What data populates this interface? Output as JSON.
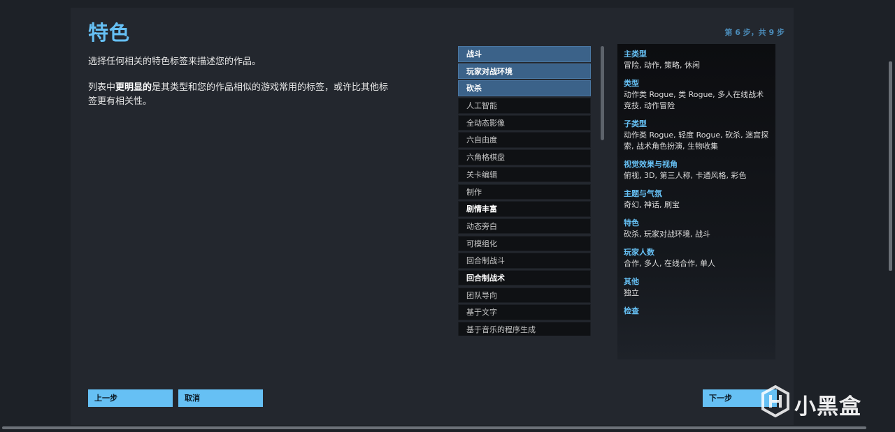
{
  "header": {
    "title": "特色",
    "step": "第 6 步，共 9 步"
  },
  "description": {
    "line1": "选择任何相关的特色标签来描述您的作品。",
    "line2_prefix": "列表中",
    "line2_bold": "更明显的",
    "line2_suffix": "是其类型和您的作品相似的游戏常用的标签，或许比其他标签更有相关性。"
  },
  "tags": [
    {
      "label": "战斗",
      "state": "selected"
    },
    {
      "label": "玩家对战环境",
      "state": "selected"
    },
    {
      "label": "砍杀",
      "state": "selected"
    },
    {
      "label": "人工智能",
      "state": "normal"
    },
    {
      "label": "全动态影像",
      "state": "normal"
    },
    {
      "label": "六自由度",
      "state": "normal"
    },
    {
      "label": "六角格棋盘",
      "state": "normal"
    },
    {
      "label": "关卡编辑",
      "state": "normal"
    },
    {
      "label": "制作",
      "state": "normal"
    },
    {
      "label": "剧情丰富",
      "state": "bold"
    },
    {
      "label": "动态旁白",
      "state": "normal"
    },
    {
      "label": "可模组化",
      "state": "normal"
    },
    {
      "label": "回合制战斗",
      "state": "normal"
    },
    {
      "label": "回合制战术",
      "state": "bold"
    },
    {
      "label": "团队导向",
      "state": "normal"
    },
    {
      "label": "基于文字",
      "state": "normal"
    },
    {
      "label": "基于音乐的程序生成",
      "state": "normal"
    }
  ],
  "summary": [
    {
      "heading": "主类型",
      "value": "冒险, 动作, 策略, 休闲"
    },
    {
      "heading": "类型",
      "value": "动作类 Rogue, 类 Rogue, 多人在线战术竞技, 动作冒险"
    },
    {
      "heading": "子类型",
      "value": "动作类 Rogue, 轻度 Rogue, 砍杀, 迷宫探索, 战术角色扮演, 生物收集"
    },
    {
      "heading": "视觉效果与视角",
      "value": "俯视, 3D, 第三人称, 卡通风格, 彩色"
    },
    {
      "heading": "主题与气氛",
      "value": "奇幻, 神话, 刷宝"
    },
    {
      "heading": "特色",
      "value": "砍杀, 玩家对战环境, 战斗"
    },
    {
      "heading": "玩家人数",
      "value": "合作, 多人, 在线合作, 单人"
    },
    {
      "heading": "其他",
      "value": "独立"
    },
    {
      "heading": "检查",
      "value": ""
    }
  ],
  "buttons": {
    "prev": "上一步",
    "cancel": "取消",
    "next": "下一步"
  },
  "watermark": {
    "text": "小黑盒",
    "icon": "heybox-logo-icon"
  },
  "colors": {
    "accent": "#66c0f4",
    "selected_tag": "#3b6289",
    "background": "#1d2127"
  }
}
